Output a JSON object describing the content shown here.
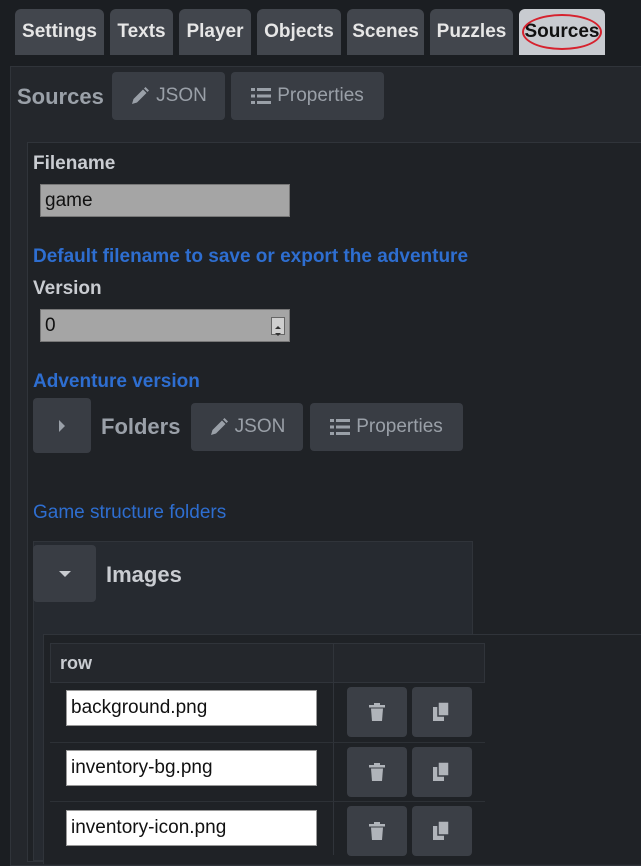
{
  "tabs": [
    {
      "label": "Settings"
    },
    {
      "label": "Texts"
    },
    {
      "label": "Player"
    },
    {
      "label": "Objects"
    },
    {
      "label": "Scenes"
    },
    {
      "label": "Puzzles"
    },
    {
      "label": "Sources"
    }
  ],
  "sources": {
    "title": "Sources",
    "json_label": "JSON",
    "properties_label": "Properties"
  },
  "filename": {
    "label": "Filename",
    "value": "game",
    "help": "Default filename to save or export the adventure"
  },
  "version": {
    "label": "Version",
    "value": "0",
    "help": "Adventure version"
  },
  "folders": {
    "title": "Folders",
    "json_label": "JSON",
    "properties_label": "Properties",
    "help": "Game structure folders"
  },
  "images": {
    "title": "Images",
    "column_header": "row",
    "rows": [
      {
        "value": "background.png"
      },
      {
        "value": "inventory-bg.png"
      },
      {
        "value": "inventory-icon.png"
      }
    ]
  }
}
